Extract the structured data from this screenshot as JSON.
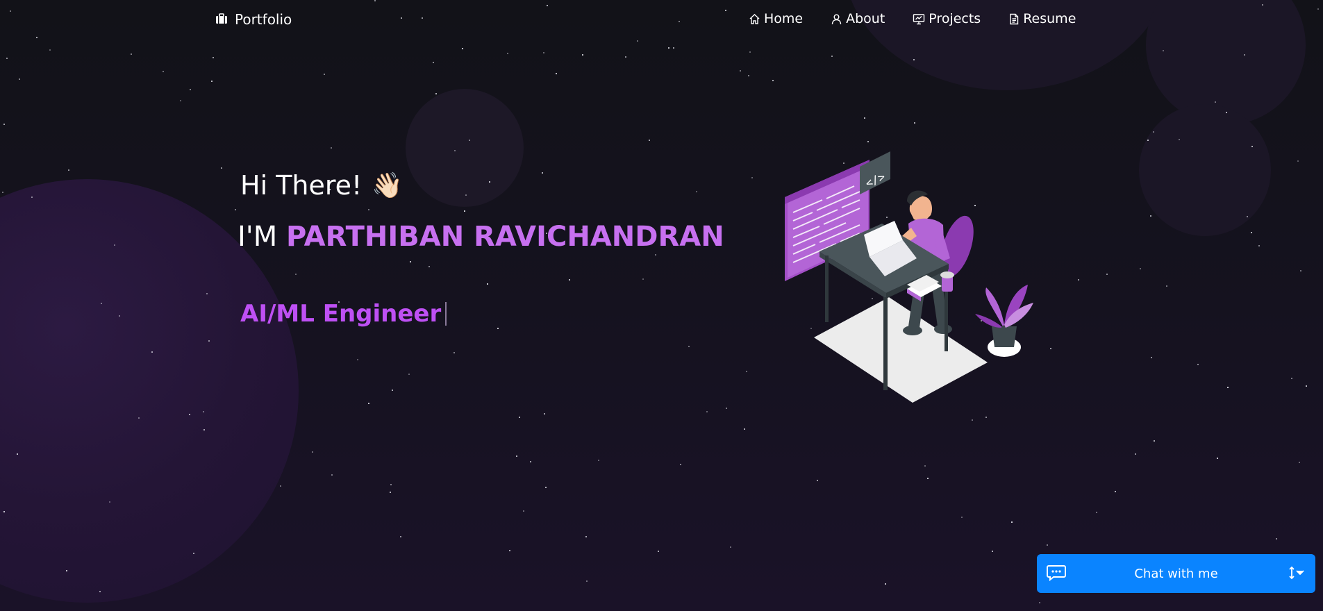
{
  "nav": {
    "brand": "Portfolio",
    "links": [
      {
        "label": "Home",
        "icon": "home-icon"
      },
      {
        "label": "About",
        "icon": "user-icon"
      },
      {
        "label": "Projects",
        "icon": "presentation-icon"
      },
      {
        "label": "Resume",
        "icon": "document-icon"
      }
    ]
  },
  "hero": {
    "greeting": "Hi There!",
    "wave_emoji": "👋🏻",
    "im_prefix": "I'M",
    "name": "PARTHIBAN RAVICHANDRAN",
    "role": "AI/ML Engineer"
  },
  "chat": {
    "label": "Chat with me"
  },
  "colors": {
    "accent": "#c770f0",
    "role_text": "#be50f4",
    "chat_blue": "#0a84ff",
    "background": "#121218"
  }
}
